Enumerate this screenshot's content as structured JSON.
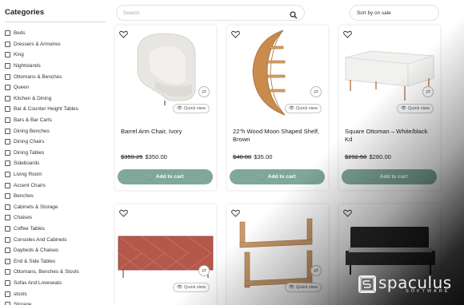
{
  "sidebar": {
    "title": "Categories",
    "items": [
      "Beds",
      "Dressers & Armoires",
      "King",
      "Nightstands",
      "Ottomans & Benches",
      "Queen",
      "Kitchen & Dining",
      "Bar & Counter Height Tables",
      "Bars & Bar Carts",
      "Dining Benches",
      "Dining Chairs",
      "Dining Tables",
      "Sideboards",
      "Living Room",
      "Accent Chairs",
      "Benches",
      "Cabinets & Storage",
      "Chaises",
      "Coffee Tables",
      "Consoles And Cabinets",
      "Daybeds & Chaises",
      "End & Side Tables",
      "Ottomans, Benches & Stools",
      "Sofas And Loveseats",
      "stools",
      "Storage"
    ]
  },
  "search": {
    "placeholder": "Search"
  },
  "sort": {
    "label": "Sort by on sale"
  },
  "products": [
    {
      "name": "Barrel Arm Chair, Ivory",
      "old_price": "$359.25",
      "price": "$350.00"
    },
    {
      "name": "22\"h Wood Moon Shaped Shelf, Brown",
      "old_price": "$40.00",
      "price": "$35.00"
    },
    {
      "name": "Square Ottoman – White/black Kd",
      "old_price": "$292.50",
      "price": "$280.00"
    }
  ],
  "card_labels": {
    "quick_view": "Quick view",
    "add_to_cart": "Add to cart"
  },
  "brand": {
    "name": "spaculus",
    "tagline": "SOFTWARE"
  },
  "colors": {
    "cart_button": "#7fa79a",
    "overlay": "#000000"
  }
}
